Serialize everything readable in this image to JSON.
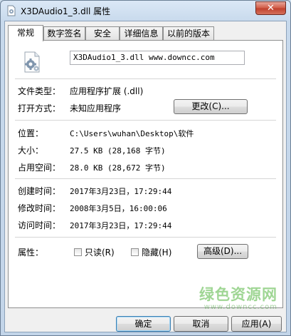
{
  "window": {
    "title": "X3DAudio1_3.dll 属性",
    "close_label": "✕",
    "colors": {
      "close": "#c0402b",
      "titlebar": "#dbe8f6"
    }
  },
  "tabs": [
    {
      "label": "常规",
      "active": true
    },
    {
      "label": "数字签名",
      "active": false
    },
    {
      "label": "安全",
      "active": false
    },
    {
      "label": "详细信息",
      "active": false
    },
    {
      "label": "以前的版本",
      "active": false
    }
  ],
  "general": {
    "icon": "dll-file-gear-icon",
    "filename": "X3DAudio1_3.dll  www.downcc.com",
    "file_type_label": "文件类型：",
    "file_type_value": "应用程序扩展 (.dll)",
    "open_with_label": "打开方式：",
    "open_with_value": "未知应用程序",
    "change_button": "更改(C)...",
    "location_label": "位置：",
    "location_value": "C:\\Users\\wuhan\\Desktop\\软件",
    "size_label": "大小：",
    "size_value": "27.5 KB (28,168 字节)",
    "disk_size_label": "占用空间：",
    "disk_size_value": "28.0 KB (28,672 字节)",
    "created_label": "创建时间：",
    "created_value": "2017年3月23日，17:29:44",
    "modified_label": "修改时间：",
    "modified_value": "2008年3月5日，16:00:06",
    "accessed_label": "访问时间：",
    "accessed_value": "2017年3月23日，17:29:44",
    "attributes_label": "属性：",
    "readonly_label": "只读(R)",
    "hidden_label": "隐藏(H)",
    "advanced_button": "高级(D)..."
  },
  "footer": {
    "ok_button": "确定",
    "cancel_button": "取消",
    "apply_button": "应用(A)"
  },
  "watermark": {
    "text": "绿色资源网",
    "url": "www.downcc.com"
  }
}
